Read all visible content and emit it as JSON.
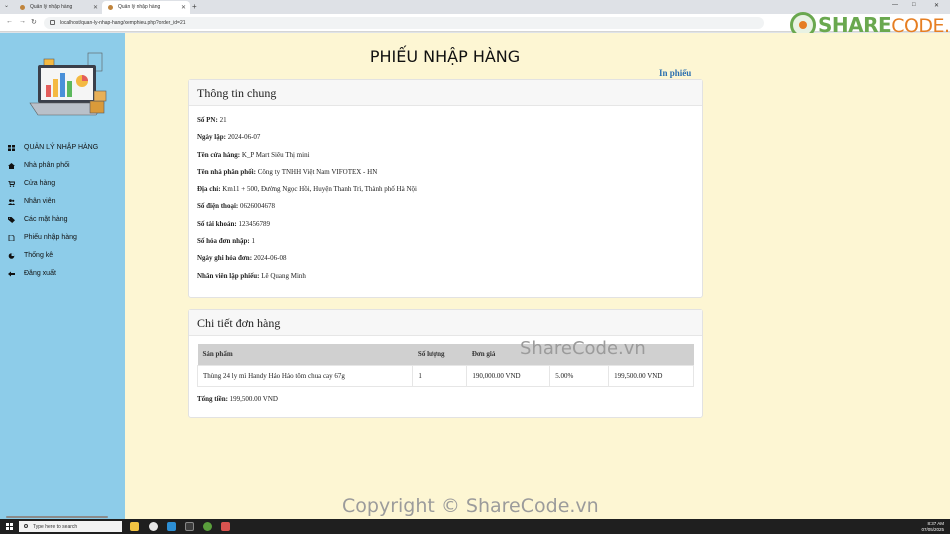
{
  "browser": {
    "tabs": [
      {
        "label": "Quản lý nhập hàng"
      },
      {
        "label": "Quản lý nhập hàng"
      }
    ],
    "url": "localhost/quan-ly-nhap-hang/xemphieu.php?order_id=21"
  },
  "watermark_brand": {
    "prefix": "SHARE",
    "suffix": "CODE.vn"
  },
  "sidebar": {
    "items": [
      {
        "label": "QUẢN LÝ NHẬP HÀNG",
        "icon": "grid-icon"
      },
      {
        "label": "Nhà phân phối",
        "icon": "home-icon"
      },
      {
        "label": "Cửa hàng",
        "icon": "cart-icon"
      },
      {
        "label": "Nhân viên",
        "icon": "users-icon"
      },
      {
        "label": "Các mặt hàng",
        "icon": "tags-icon"
      },
      {
        "label": "Phiếu nhập hàng",
        "icon": "file-icon"
      },
      {
        "label": "Thống kê",
        "icon": "pie-chart-icon"
      },
      {
        "label": "Đăng xuất",
        "icon": "logout-icon"
      }
    ]
  },
  "page": {
    "title": "PHIẾU NHẬP HÀNG",
    "print_label": "In phiếu"
  },
  "general": {
    "header": "Thông tin chung",
    "fields": [
      {
        "label": "Số PN:",
        "value": "21"
      },
      {
        "label": "Ngày lập:",
        "value": "2024-06-07"
      },
      {
        "label": "Tên cửa hàng:",
        "value": "K_P Mart Siêu Thị mini"
      },
      {
        "label": "Tên nhà phân phối:",
        "value": "Công ty TNHH Việt Nam VIFOTEX - HN"
      },
      {
        "label": "Địa chỉ:",
        "value": "Km11 + 500, Đường Ngọc Hồi, Huyện Thanh Trì, Thành phố Hà Nội"
      },
      {
        "label": "Số điện thoại:",
        "value": "0626004678"
      },
      {
        "label": "Số tài khoản:",
        "value": "123456789"
      },
      {
        "label": "Số hóa đơn nhập:",
        "value": "1"
      },
      {
        "label": "Ngày ghi hóa đơn:",
        "value": "2024-06-08"
      },
      {
        "label": "Nhân viên lập phiếu:",
        "value": "Lê Quang Minh"
      }
    ]
  },
  "details": {
    "header": "Chi tiết đơn hàng",
    "columns": [
      "Sản phẩm",
      "Số lượng",
      "Đơn giá",
      "",
      ""
    ],
    "rows": [
      [
        "Thùng 24 ly mì Handy Hảo Hảo tôm chua cay 67g",
        "1",
        "190,000.00 VND",
        "5.00%",
        "199,500.00 VND"
      ]
    ],
    "total_label": "Tổng tiền:",
    "total_value": "199,500.00 VND"
  },
  "overlay": {
    "table_watermark": "ShareCode.vn",
    "footer_watermark": "Copyright © ShareCode.vn"
  },
  "taskbar": {
    "search_placeholder": "Type here to search",
    "time": "8:37 AM",
    "date": "07/05/2025"
  }
}
